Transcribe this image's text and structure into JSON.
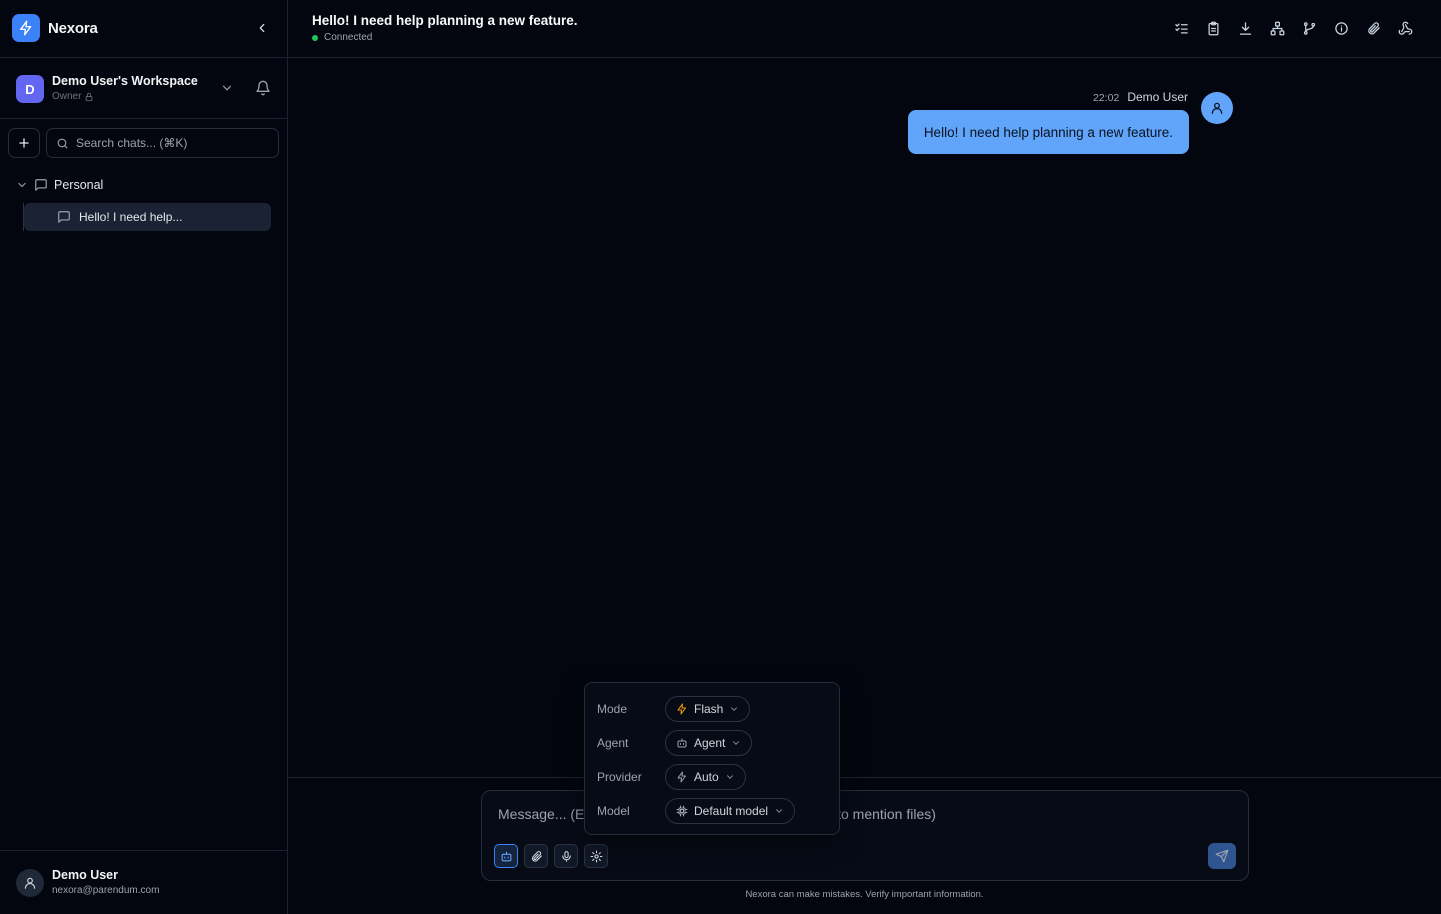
{
  "app": {
    "name": "Nexora"
  },
  "workspace": {
    "initial": "D",
    "name": "Demo User's Workspace",
    "role": "Owner"
  },
  "sidebar": {
    "search_placeholder": "Search chats... (⌘K)",
    "folder": "Personal",
    "chats": [
      {
        "label": "Hello! I need help..."
      }
    ]
  },
  "user": {
    "name": "Demo User",
    "email": "nexora@parendum.com"
  },
  "header": {
    "title": "Hello! I need help planning a new feature.",
    "status": "Connected",
    "tools": [
      "list-icon",
      "clipboard-icon",
      "download-icon",
      "sitemap-icon",
      "git-branch-icon",
      "info-icon",
      "paperclip-icon",
      "webhook-icon"
    ]
  },
  "message": {
    "time": "22:02",
    "author": "Demo User",
    "text": "Hello! I need help planning a new feature."
  },
  "composer": {
    "placeholder": "Message... (Enter to send, Shift+Enter for new line, @ to mention files)",
    "disclaimer": "Nexora can make mistakes. Verify important information."
  },
  "settings_popover": {
    "rows": [
      {
        "label": "Mode",
        "value": "Flash",
        "icon": "zap-icon"
      },
      {
        "label": "Agent",
        "value": "Agent",
        "icon": "bot-icon"
      },
      {
        "label": "Provider",
        "value": "Auto",
        "icon": "zap-icon"
      },
      {
        "label": "Model",
        "value": "Default model",
        "icon": "cpu-icon"
      }
    ]
  },
  "colors": {
    "accent": "#3b82f6",
    "bubble": "#60a5fa",
    "status": "#22c55e",
    "background": "#03060f",
    "flash": "#f59e0b"
  }
}
